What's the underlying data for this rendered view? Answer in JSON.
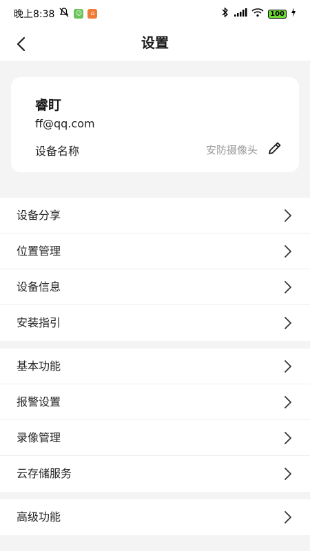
{
  "status_bar": {
    "time": "晚上8:38",
    "battery": "100"
  },
  "header": {
    "title": "设置"
  },
  "device_card": {
    "brand": "睿盯",
    "account": "ff@qq.com",
    "name_label": "设备名称",
    "name_value": "安防摄像头"
  },
  "sections": [
    {
      "items": [
        {
          "label": "设备分享"
        },
        {
          "label": "位置管理"
        },
        {
          "label": "设备信息"
        },
        {
          "label": "安装指引"
        }
      ]
    },
    {
      "items": [
        {
          "label": "基本功能"
        },
        {
          "label": "报警设置"
        },
        {
          "label": "录像管理"
        },
        {
          "label": "云存储服务"
        }
      ]
    },
    {
      "items": [
        {
          "label": "高级功能"
        }
      ]
    }
  ],
  "colors": {
    "background": "#f4f4f4",
    "card": "#ffffff",
    "muted_text": "#999999",
    "battery_fill": "#6fdc35"
  },
  "icons": {
    "back": "chevron-left-icon",
    "edit": "pencil-icon",
    "row_arrow": "chevron-right-icon"
  }
}
